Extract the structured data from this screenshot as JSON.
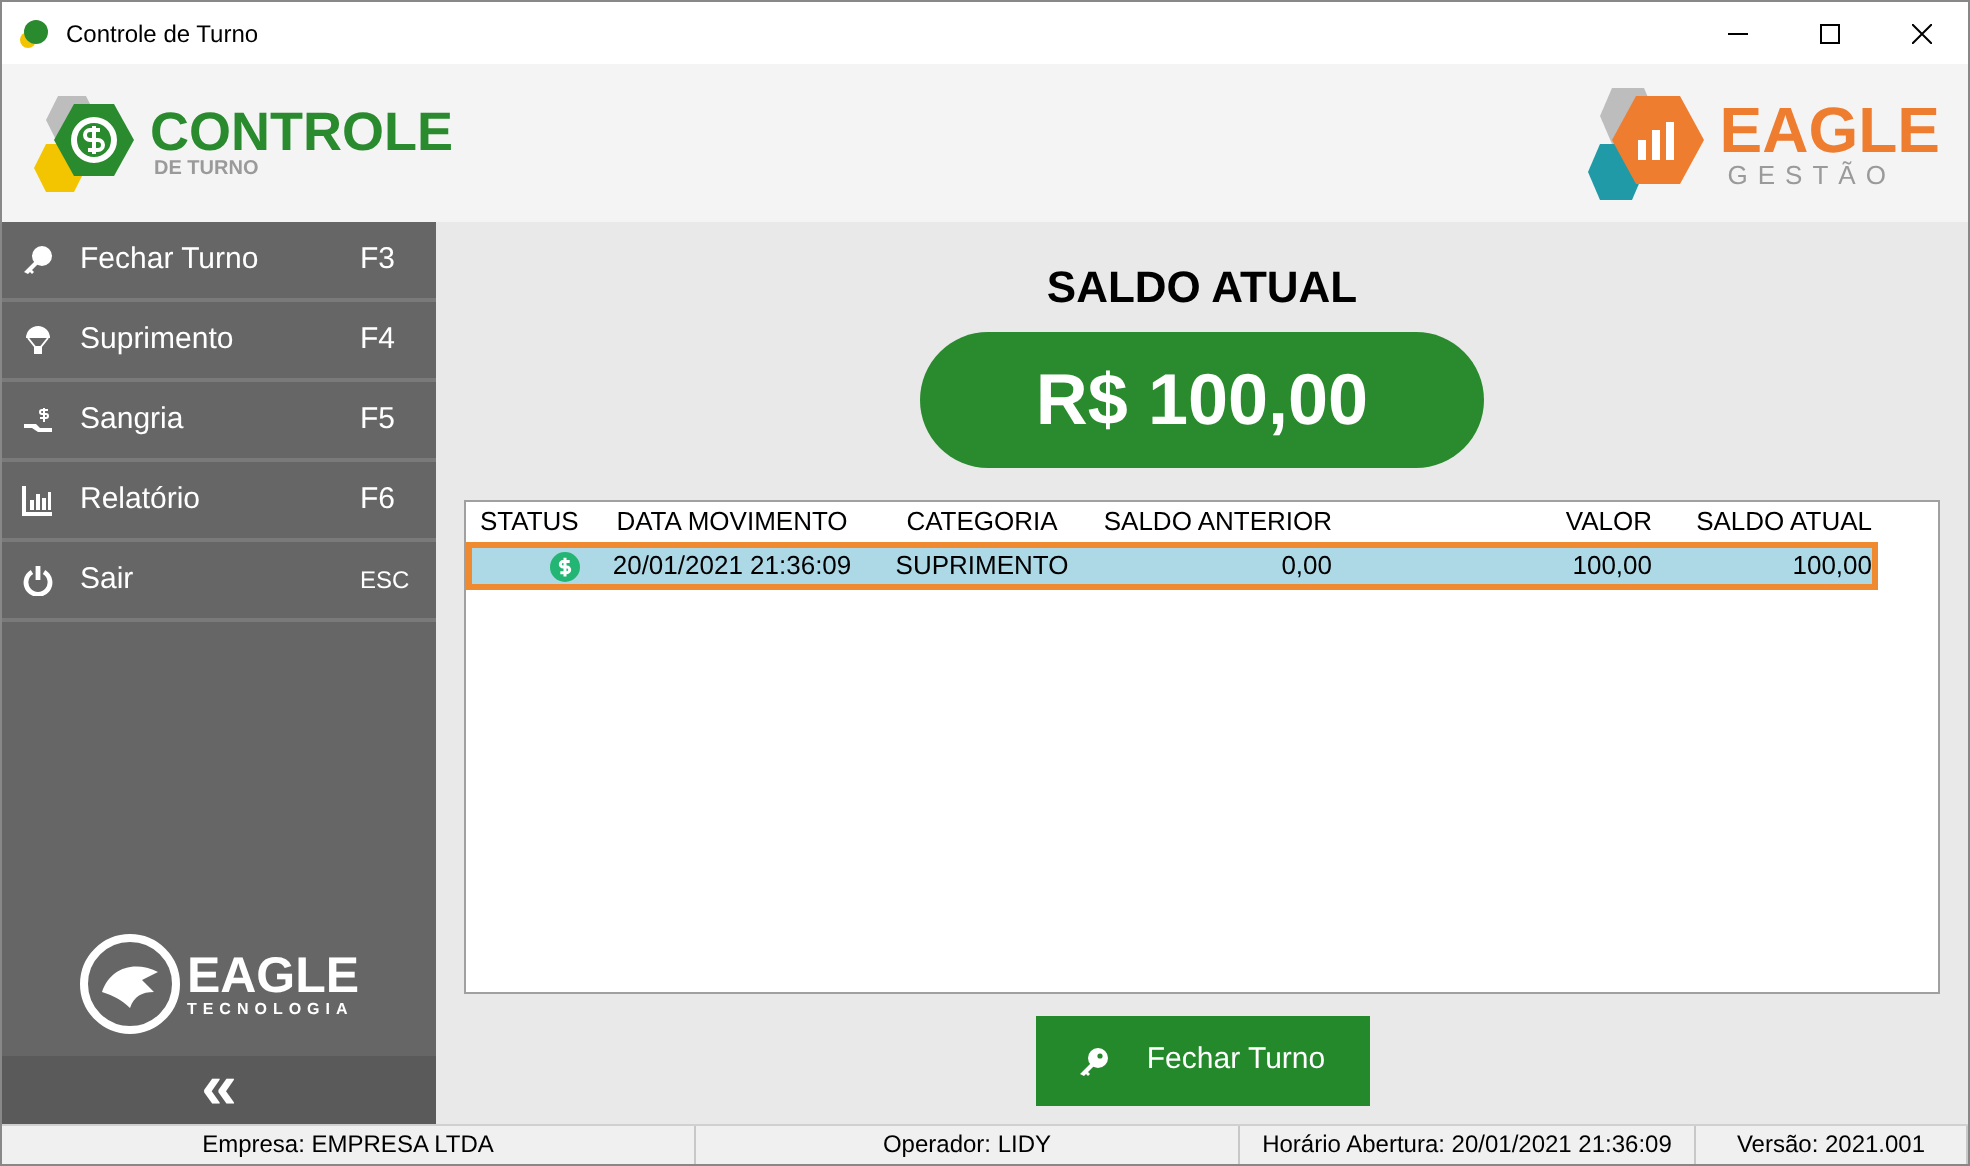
{
  "window": {
    "title": "Controle de Turno"
  },
  "logo": {
    "title": "CONTROLE",
    "subtitle": "DE TURNO"
  },
  "brand": {
    "title": "EAGLE",
    "subtitle": "GESTÃO"
  },
  "sidebar": {
    "items": [
      {
        "label": "Fechar Turno",
        "shortcut": "F3"
      },
      {
        "label": "Suprimento",
        "shortcut": "F4"
      },
      {
        "label": "Sangria",
        "shortcut": "F5"
      },
      {
        "label": "Relatório",
        "shortcut": "F6"
      },
      {
        "label": "Sair",
        "shortcut": "ESC"
      }
    ],
    "footer_logo": {
      "title": "EAGLE",
      "subtitle": "TECNOLOGIA"
    },
    "collapse": "«"
  },
  "balance": {
    "label": "SALDO ATUAL",
    "value": "R$ 100,00"
  },
  "table": {
    "columns": [
      "STATUS",
      "DATA MOVIMENTO",
      "CATEGORIA",
      "SALDO ANTERIOR",
      "VALOR",
      "SALDO ATUAL"
    ],
    "rows": [
      {
        "selected": true,
        "cells": [
          "",
          "20/01/2021 21:36:09",
          "SUPRIMENTO",
          "0,00",
          "100,00",
          "100,00"
        ]
      }
    ]
  },
  "action_button": "Fechar Turno",
  "status_bar": [
    "Empresa: EMPRESA LTDA",
    "Operador: LIDY",
    "Horário Abertura: 20/01/2021 21:36:09",
    "Versão: 2021.001"
  ]
}
